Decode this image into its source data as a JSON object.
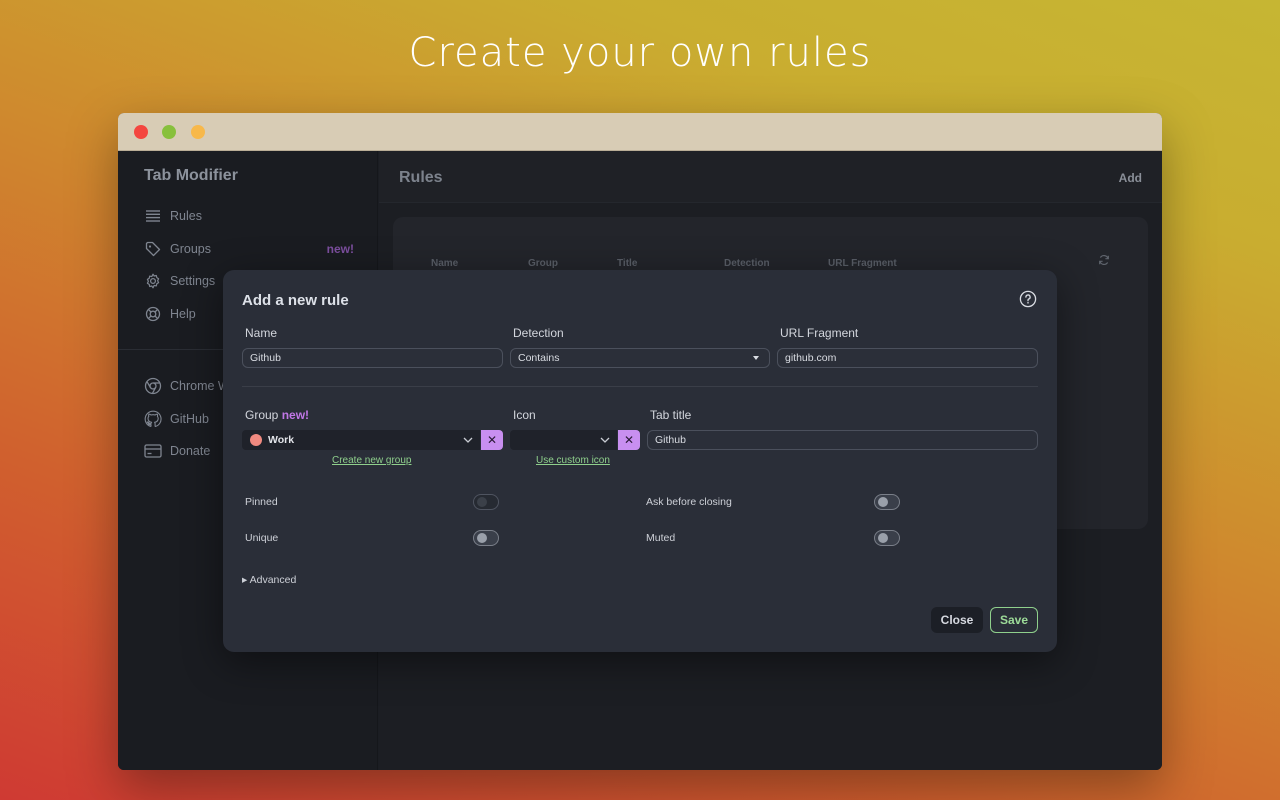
{
  "headline": "Create your own rules",
  "sidebar": {
    "app_title": "Tab Modifier",
    "items": [
      {
        "label": "Rules",
        "icon": "list-icon"
      },
      {
        "label": "Groups",
        "icon": "tag-icon",
        "badge": "new!"
      },
      {
        "label": "Settings",
        "icon": "gear-icon"
      },
      {
        "label": "Help",
        "icon": "lifebuoy-icon"
      }
    ],
    "links": [
      {
        "label": "Chrome W",
        "icon": "chrome-icon"
      },
      {
        "label": "GitHub",
        "icon": "github-icon"
      },
      {
        "label": "Donate",
        "icon": "card-icon"
      }
    ]
  },
  "main": {
    "title": "Rules",
    "add_label": "Add",
    "columns": [
      "Name",
      "Group",
      "Title",
      "Detection",
      "URL Fragment"
    ]
  },
  "modal": {
    "title": "Add a new rule",
    "name_label": "Name",
    "name_value": "Github",
    "detection_label": "Detection",
    "detection_value": "Contains",
    "url_label": "URL Fragment",
    "url_value": "github.com",
    "group_label": "Group",
    "group_new": "new!",
    "group_value": "Work",
    "group_color": "#f08a80",
    "create_group_link": "Create new group",
    "icon_label": "Icon",
    "icon_value": "",
    "custom_icon_link": "Use custom icon",
    "tab_title_label": "Tab title",
    "tab_title_value": "Github",
    "toggles": {
      "pinned": "Pinned",
      "unique": "Unique",
      "ask_before_closing": "Ask before closing",
      "muted": "Muted"
    },
    "advanced_label": "Advanced",
    "close_label": "Close",
    "save_label": "Save"
  },
  "colors": {
    "accent_purple": "#c88ff0",
    "accent_green": "#8fd08c"
  }
}
